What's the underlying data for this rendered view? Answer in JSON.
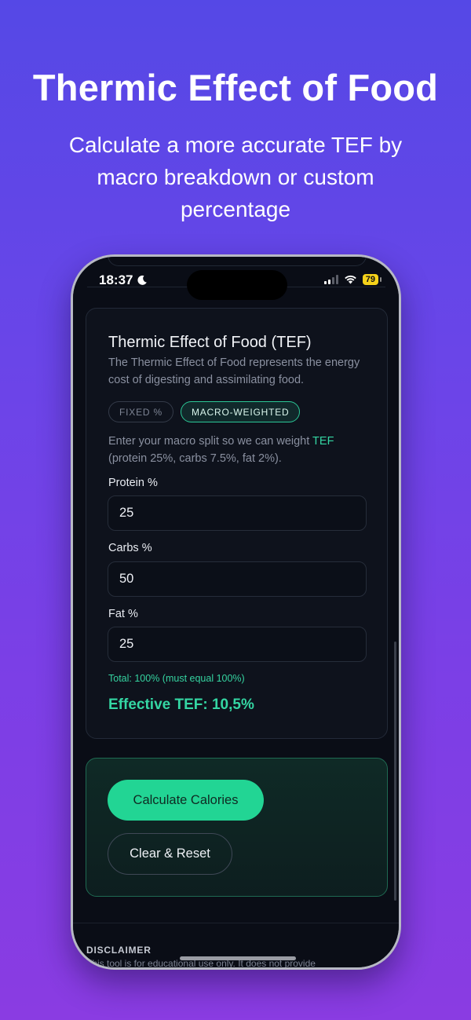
{
  "promo": {
    "headline": "Thermic Effect of Food",
    "subhead": "Calculate a more accurate TEF by macro breakdown or custom percentage"
  },
  "status_bar": {
    "time": "18:37",
    "battery": "79"
  },
  "tef_card": {
    "title": "Thermic Effect of Food (TEF)",
    "description": "The Thermic Effect of Food represents the energy cost of digesting and assimilating food.",
    "tabs": [
      {
        "label": "FIXED %",
        "active": false
      },
      {
        "label": "MACRO-WEIGHTED",
        "active": true
      }
    ],
    "instruction_pre": "Enter your macro split so we can weight ",
    "instruction_highlight": "TEF",
    "instruction_post": " (protein 25%, carbs 7.5%, fat 2%).",
    "fields": [
      {
        "label": "Protein %",
        "value": "25"
      },
      {
        "label": "Carbs %",
        "value": "50"
      },
      {
        "label": "Fat %",
        "value": "25"
      }
    ],
    "total_text": "Total: 100% (must equal 100%)",
    "effective_text": "Effective TEF: 10,5%"
  },
  "actions": {
    "calculate_label": "Calculate Calories",
    "reset_label": "Clear & Reset"
  },
  "disclaimer": {
    "heading": "DISCLAIMER",
    "text": "This tool is for educational use only. It does not provide"
  },
  "colors": {
    "accent": "#22d594",
    "highlight": "#34d6a3",
    "background_top": "#5548e6",
    "background_bottom": "#8a3ce2"
  }
}
